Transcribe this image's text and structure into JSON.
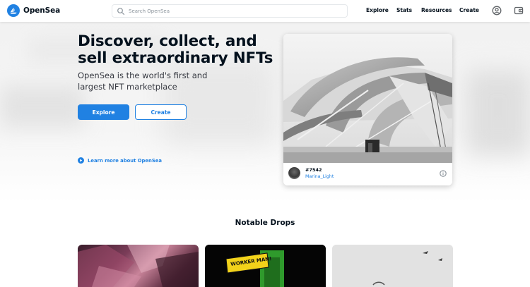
{
  "header": {
    "brand": "OpenSea",
    "search_placeholder": "Search OpenSea",
    "nav": {
      "explore": "Explore",
      "stats": "Stats",
      "resources": "Resources",
      "create": "Create"
    },
    "icons": {
      "logo": "opensea-logo-icon",
      "search": "search-icon",
      "account": "account-icon",
      "wallet": "wallet-icon"
    }
  },
  "hero": {
    "title": "Discover, collect, and sell extraordinary NFTs",
    "subtitle": "OpenSea is the world's first and largest NFT marketplace",
    "explore_label": "Explore",
    "create_label": "Create",
    "learn_more": "Learn more about OpenSea"
  },
  "featured": {
    "token": "#7542",
    "creator": "Marina_Light"
  },
  "drops": {
    "title": "Notable Drops",
    "items": [
      {
        "sign_text": ""
      },
      {
        "sign_text": "WORKER MAN!"
      },
      {
        "sign_text": ""
      }
    ]
  },
  "colors": {
    "accent": "#2081e2",
    "text": "#04111d",
    "subtext": "#353840"
  }
}
